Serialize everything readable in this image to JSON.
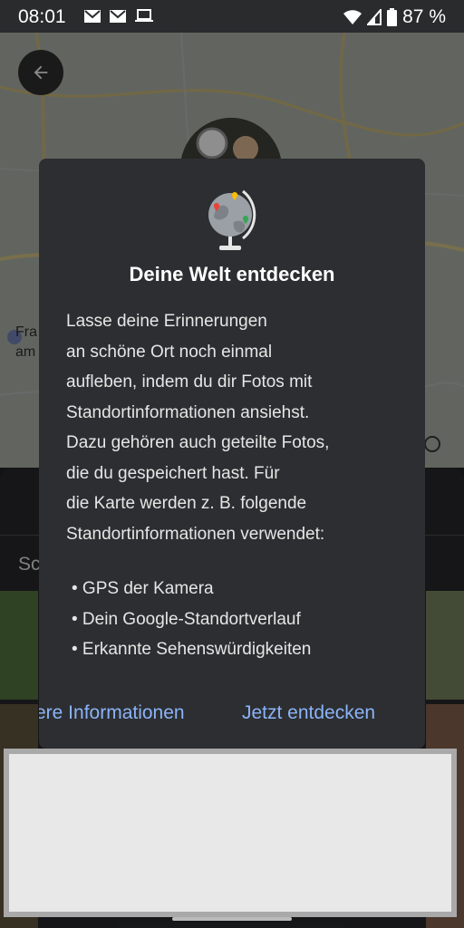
{
  "status_bar": {
    "time": "08:01",
    "left_icons": [
      "gmail-icon",
      "gmail-icon",
      "laptop-icon"
    ],
    "right_icons": [
      "wifi-icon",
      "signal-icon",
      "battery-icon"
    ],
    "battery": "87 %"
  },
  "map": {
    "partial_label_line1": "Fra",
    "partial_label_line2": "am",
    "info_icon": "info-icon"
  },
  "sheet": {
    "search_partial": "Sc"
  },
  "dialog": {
    "icon": "globe-icon",
    "title": "Deine Welt entdecken",
    "body": "Lasse deine Erinnerungen\nan schöne Ort noch einmal\naufleben, indem du dir Fotos mit\nStandortinformationen ansiehst.\nDazu gehören auch geteilte Fotos,\ndie du gespeichert hast. Für\ndie Karte werden z. B. folgende\nStandortinformationen verwendet:",
    "list": [
      "• GPS der Kamera",
      "• Dein Google-Standortverlauf",
      "• Erkannte Sehenswürdigkeiten"
    ],
    "secondary_action": "ere Informationen",
    "primary_action": "Jetzt entdecken"
  },
  "colors": {
    "dialog_bg": "#2d2e31",
    "action_blue": "#8ab4f8",
    "status_bar_bg": "#2a2b2d"
  }
}
